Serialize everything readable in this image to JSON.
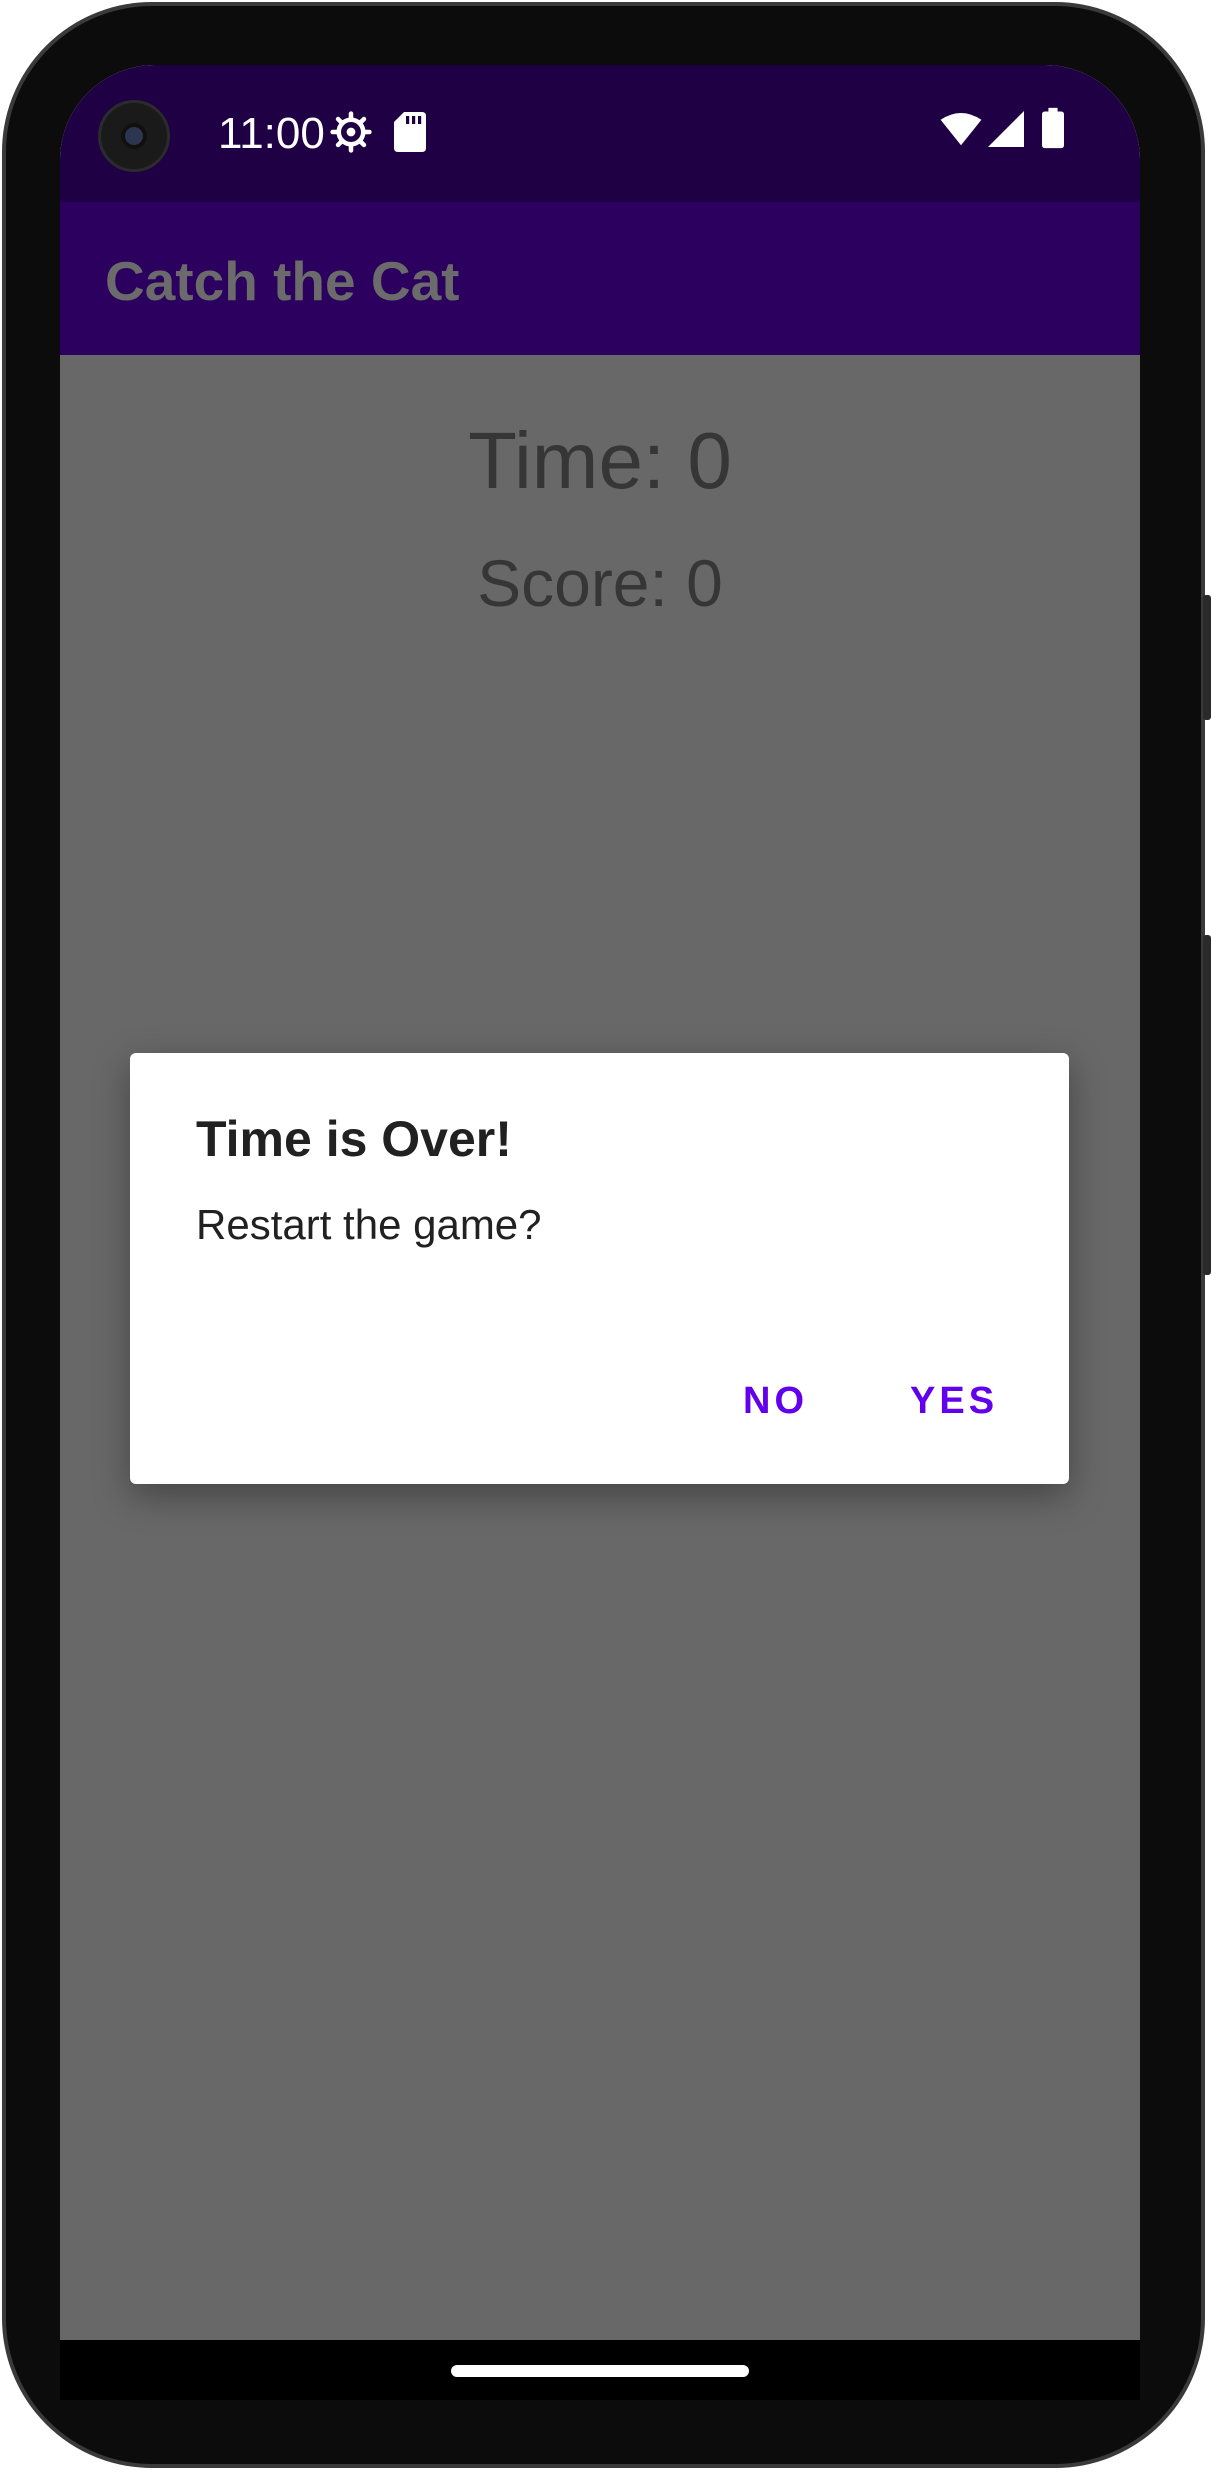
{
  "status_bar": {
    "time": "11:00",
    "icons": [
      "settings-gear-icon",
      "sd-card-icon",
      "wifi-icon",
      "cell-signal-icon",
      "battery-icon"
    ]
  },
  "app_bar": {
    "title": "Catch the Cat"
  },
  "game": {
    "time_text": "Time: 0",
    "score_text": "Score: 0"
  },
  "dialog": {
    "title": "Time is Over!",
    "message": "Restart the game?",
    "negative_label": "NO",
    "positive_label": "YES"
  },
  "colors": {
    "status_bar": "#1f0044",
    "app_bar": "#2c005f",
    "scrim_background": "#686868",
    "dialog_button": "#6200ee"
  }
}
